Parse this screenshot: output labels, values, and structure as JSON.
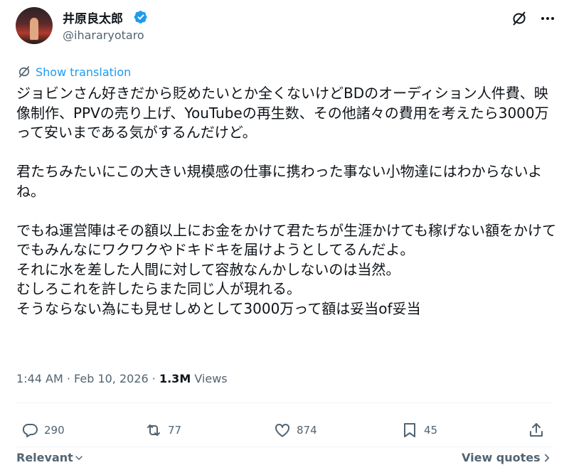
{
  "author": {
    "display_name": "井原良太郎",
    "handle": "@ihararyotaro",
    "verified": true
  },
  "translate": {
    "label": "Show translation"
  },
  "tweet": {
    "text": "ジョビンさん好きだから貶めたいとか全くないけどBDのオーディション人件費、映像制作、PPVの売り上げ、YouTubeの再生数、その他諸々の費用を考えたら3000万って安いまである気がするんだけど。\n\n君たちみたいにこの大きい規模感の仕事に携わった事ない小物達にはわからないよね。\n\nでもね運営陣はその額以上にお金をかけて君たちが生涯かけても稼げない額をかけてでもみんなにワクワクやドキドキを届けようとしてるんだよ。\nそれに水を差した人間に対して容赦なんかしないのは当然。\nむしろこれを許したらまた同じ人が現れる。\nそうならない為にも見せしめとして3000万って額は妥当of妥当"
  },
  "meta": {
    "time": "1:44 AM",
    "sep1": " · ",
    "date": "Feb 10, 2026",
    "sep2": " · ",
    "views_count": "1.3M",
    "views_label": " Views"
  },
  "actions": {
    "replies": "290",
    "reposts": "77",
    "likes": "874",
    "bookmarks": "45"
  },
  "footer": {
    "sort_label": "Relevant",
    "quotes_label": "View quotes"
  },
  "colors": {
    "accent": "#1d9bf0",
    "secondary_text": "#536471",
    "primary_text": "#0f1419"
  },
  "icons": [
    "verified-badge-icon",
    "grok-icon",
    "more-icon",
    "translate-icon",
    "reply-icon",
    "repost-icon",
    "like-icon",
    "bookmark-icon",
    "share-icon",
    "chevron-down-icon",
    "chevron-right-icon"
  ]
}
